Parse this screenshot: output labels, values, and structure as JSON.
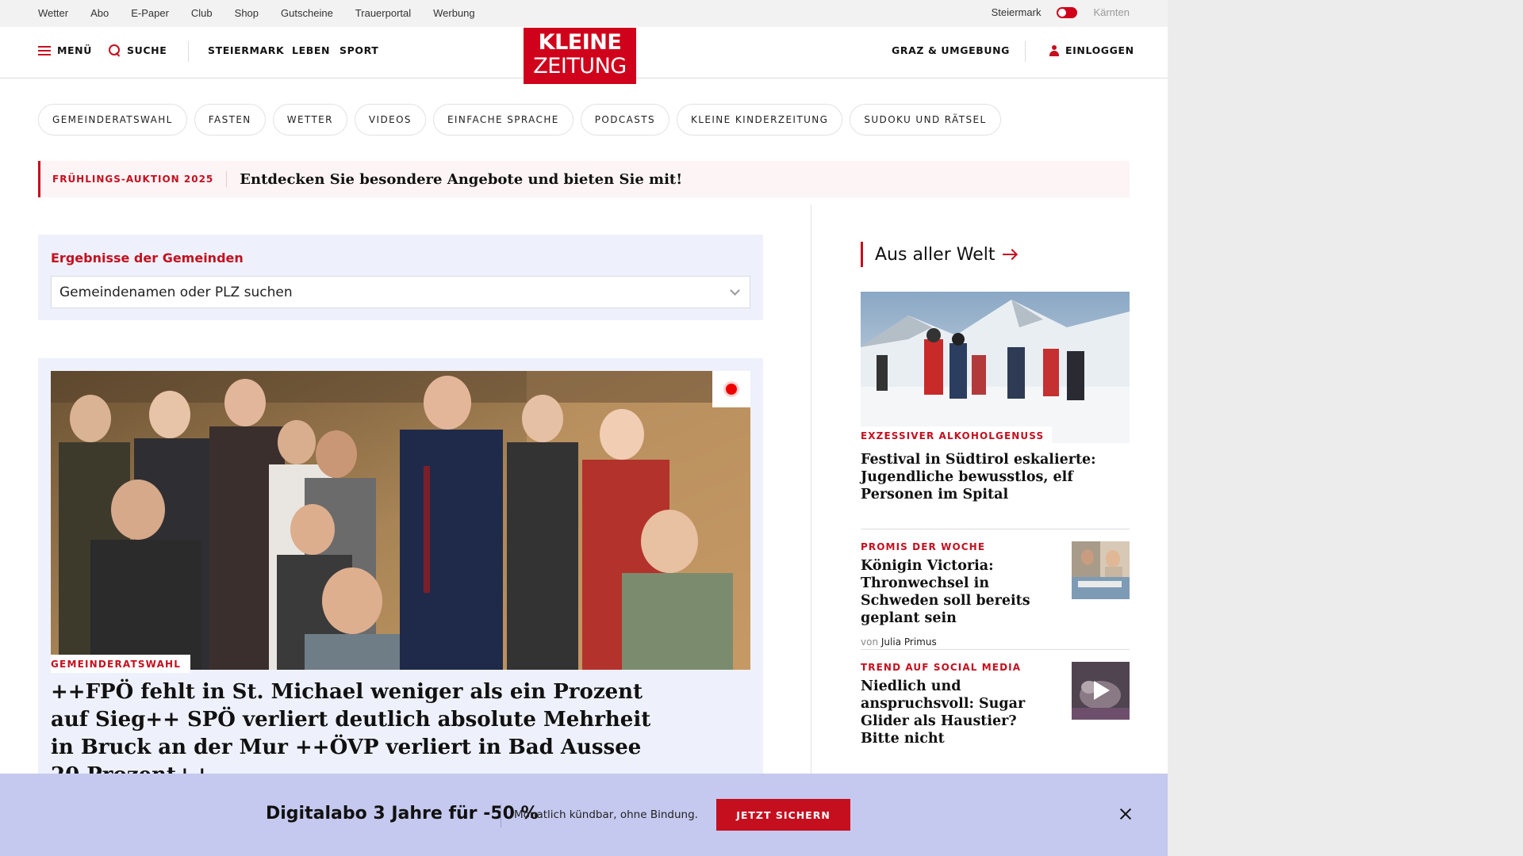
{
  "topbar": {
    "links": [
      "Wetter",
      "Abo",
      "E-Paper",
      "Club",
      "Shop",
      "Gutscheine",
      "Trauerportal",
      "Werbung"
    ],
    "region_active": "Steiermark",
    "region_inactive": "Kärnten"
  },
  "header": {
    "menu_label": "MENÜ",
    "search_label": "SUCHE",
    "nav": [
      "STEIERMARK",
      "LEBEN",
      "SPORT"
    ],
    "logo_line1": "KLEINE",
    "logo_line2": "ZEITUNG",
    "region_link": "GRAZ & UMGEBUNG",
    "login_label": "EINLOGGEN"
  },
  "pills": [
    "GEMEINDERATSWAHL",
    "FASTEN",
    "WETTER",
    "VIDEOS",
    "EINFACHE SPRACHE",
    "PODCASTS",
    "KLEINE KINDERZEITUNG",
    "SUDOKU UND RÄTSEL"
  ],
  "promo": {
    "tag": "FRÜHLINGS-AUKTION 2025",
    "text": "Entdecken Sie besondere Angebote und bieten Sie mit!"
  },
  "gemeinden": {
    "title": "Ergebnisse der Gemeinden",
    "select_placeholder": "Gemeindenamen oder PLZ suchen"
  },
  "hero": {
    "tag": "GEMEINDERATSWAHL",
    "title": "++FPÖ fehlt in St. Michael weniger als ein Prozent auf Sieg++ SPÖ verliert deutlich absolute Mehrheit in Bruck an der Mur ++ÖVP verliert in Bad Aussee 20 Prozent++"
  },
  "sidebar": {
    "section_title": "Aus aller Welt",
    "top_article": {
      "tag": "EXZESSIVER ALKOHOLGENUSS",
      "title": "Festival in Südtirol eskalierte: Jugendliche bewusstlos, elf Personen im Spital"
    },
    "items": [
      {
        "tag": "PROMIS DER WOCHE",
        "title": "Königin Victoria: Thronwechsel in Schweden soll bereits geplant sein",
        "author_prefix": "von",
        "author": "Julia Primus"
      },
      {
        "tag": "TREND AUF SOCIAL MEDIA",
        "title": "Niedlich und anspruchsvoll: Sugar Glider als Haustier? Bitte nicht"
      }
    ]
  },
  "offer": {
    "title": "Digitalabo 3 Jahre für -50 %",
    "text": "Monatlich kündbar, ohne Bindung.",
    "button": "JETZT SICHERN"
  },
  "colors": {
    "brand_red": "#d0021b",
    "accent_red": "#c50f1f",
    "panel_blue": "#eef1fb",
    "offer_bg": "#c5c9ef"
  }
}
